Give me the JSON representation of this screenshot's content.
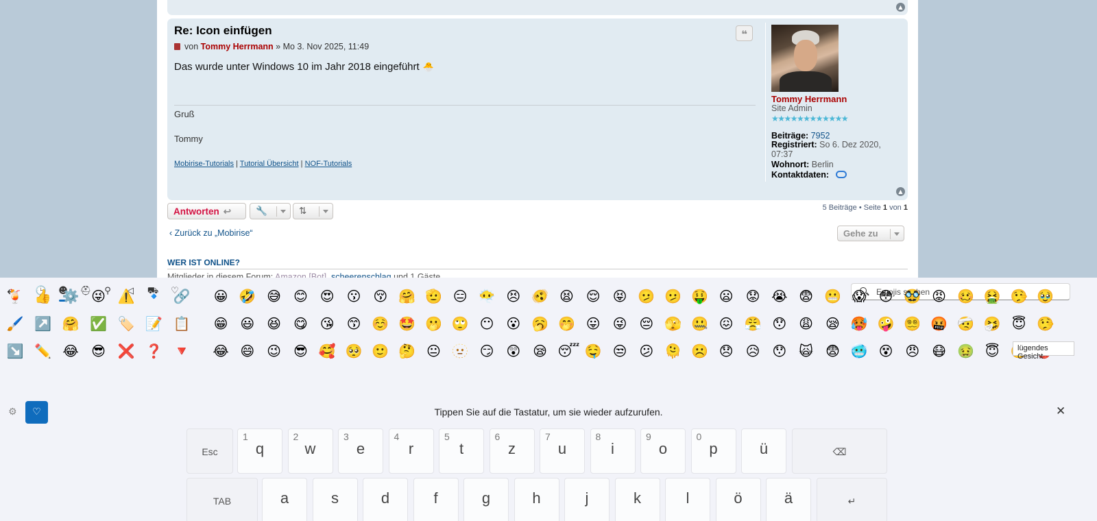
{
  "post": {
    "title": "Re: Icon einfügen",
    "by": "von",
    "author": "Tommy Herrmann",
    "date": "» Mo 3. Nov 2025, 11:49",
    "body": "Das wurde unter Windows 10 im Jahr 2018 eingeführt",
    "body_emoji": "🐣",
    "sig_line1": "Gruß",
    "sig_line2": "Tommy",
    "sig_links": [
      "Mobirise-Tutorials",
      "Tutorial Übersicht",
      "NOF-Tutorials"
    ],
    "sig_link_separator": "|",
    "quote_icon": "quote-icon"
  },
  "profile": {
    "name": "Tommy Herrmann",
    "rank": "Site Admin",
    "stars": "★★★★★★★★★★★★",
    "posts_label": "Beiträge:",
    "posts_value": "7952",
    "registered_label": "Registriert:",
    "registered_value": "So 6. Dez 2020, 07:37",
    "location_label": "Wohnort:",
    "location_value": "Berlin",
    "contact_label": "Kontaktdaten:"
  },
  "actions": {
    "reply_label": "Antworten",
    "pagination_text": "5 Beiträge • Seite",
    "pagination_page": "1",
    "pagination_of": "von",
    "pagination_total": "1",
    "back_link": "Zurück zu „Mobirise“",
    "jump_label": "Gehe zu"
  },
  "online": {
    "heading": "WER IST ONLINE?",
    "text_prefix": "Mitglieder in diesem Forum:",
    "bot": "Amazon [Bot]",
    "member": "scheerenschlag",
    "text_suffix": "und 1 Gäste"
  },
  "keyboard": {
    "search_placeholder": "Emojis suchen",
    "tooltip": "lügendes Gesicht",
    "hint": "Tippen Sie auf die Tastatur, um sie wieder aufzurufen.",
    "categories": [
      "clock-icon",
      "smiley-icon",
      "people-icon",
      "celebration-icon",
      "food-icon",
      "car-icon",
      "heart-icon"
    ],
    "recent_emojis": [
      [
        "🍹",
        "👍",
        "⚙️",
        "😜",
        "⚠️",
        "🔹",
        "🔗"
      ],
      [
        "🖌️",
        "↗️",
        "🤗",
        "✅",
        "🏷️",
        "📝",
        "📋"
      ],
      [
        "↘️",
        "✏️",
        "😂",
        "😎",
        "❌",
        "❓",
        "🔻"
      ]
    ],
    "smileys": [
      [
        "😀",
        "🤣",
        "😅",
        "😊",
        "😍",
        "😗",
        "😚",
        "🤗",
        "🫡",
        "😑",
        "😶‍🌫️",
        "😣",
        "🫨",
        "😫",
        "😌",
        "😝",
        "🫤",
        "🫤",
        "🤑",
        "😦",
        "😟",
        "😭",
        "😨",
        "😬",
        "😱",
        "😳",
        "🥸",
        "😡",
        "🥴",
        "🤮",
        "🤥",
        "🥹"
      ],
      [
        "😁",
        "😃",
        "😆",
        "😋",
        "😘",
        "😙",
        "☺️",
        "🤩",
        "🫢",
        "🙄",
        "😶",
        "😮",
        "🥱",
        "🤭",
        "😛",
        "😜",
        "😔",
        "🫣",
        "🤐",
        "😖",
        "😤",
        "😯",
        "😩",
        "😪",
        "🥵",
        "🤪",
        "😵‍💫",
        "🤬",
        "🤕",
        "🤧",
        "😇",
        "🤥"
      ],
      [
        "😂",
        "😄",
        "😉",
        "😎",
        "🥰",
        "🥺",
        "🙂",
        "🤔",
        "😐",
        "🫥",
        "😏",
        "😲",
        "😪",
        "😴",
        "🤤",
        "😒",
        "😕",
        "🫠",
        "☹️",
        "😞",
        "😥",
        "😯",
        "🙀",
        "😨",
        "🥶",
        "😵",
        "😠",
        "😷",
        "🤢",
        "😇",
        "🥺",
        "👺"
      ]
    ],
    "row1": [
      {
        "label": "Esc",
        "num": ""
      },
      {
        "label": "q",
        "num": "1"
      },
      {
        "label": "w",
        "num": "2"
      },
      {
        "label": "e",
        "num": "3"
      },
      {
        "label": "r",
        "num": "4"
      },
      {
        "label": "t",
        "num": "5"
      },
      {
        "label": "z",
        "num": "6"
      },
      {
        "label": "u",
        "num": "7"
      },
      {
        "label": "i",
        "num": "8"
      },
      {
        "label": "o",
        "num": "9"
      },
      {
        "label": "p",
        "num": "0"
      },
      {
        "label": "ü",
        "num": ""
      },
      {
        "label": "⌫",
        "num": ""
      }
    ],
    "row2": [
      {
        "label": "TAB",
        "num": ""
      },
      {
        "label": "a",
        "num": ""
      },
      {
        "label": "s",
        "num": ""
      },
      {
        "label": "d",
        "num": ""
      },
      {
        "label": "f",
        "num": ""
      },
      {
        "label": "g",
        "num": ""
      },
      {
        "label": "h",
        "num": ""
      },
      {
        "label": "j",
        "num": ""
      },
      {
        "label": "k",
        "num": ""
      },
      {
        "label": "l",
        "num": ""
      },
      {
        "label": "ö",
        "num": ""
      },
      {
        "label": "ä",
        "num": ""
      },
      {
        "label": "↵",
        "num": ""
      }
    ]
  },
  "colors": {
    "author": "#aa0000",
    "link": "#105289",
    "reply": "#d31141",
    "accent": "#0f6cbd"
  }
}
